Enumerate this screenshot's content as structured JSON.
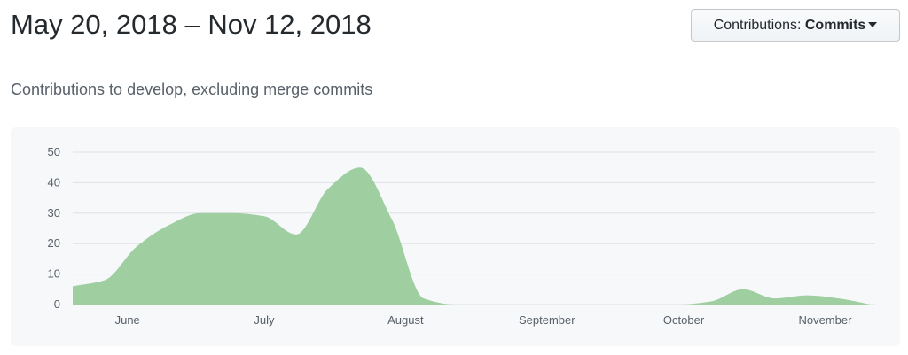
{
  "header": {
    "date_range": "May 20, 2018 – Nov 12, 2018",
    "contributions_button": {
      "prefix": "Contributions: ",
      "value": "Commits"
    }
  },
  "subtitle": "Contributions to develop, excluding merge commits",
  "colors": {
    "area_fill": "#9fcea1",
    "grid": "#dfe2e5",
    "chart_bg": "#f6f8fa"
  },
  "chart_data": {
    "type": "area",
    "title": "",
    "xlabel": "",
    "ylabel": "",
    "ylim": [
      0,
      50
    ],
    "yticks": [
      0,
      10,
      20,
      30,
      40,
      50
    ],
    "xlim": [
      "2018-05-20",
      "2018-11-12"
    ],
    "xtick_labels": [
      {
        "label": "June",
        "date": "2018-06-01"
      },
      {
        "label": "July",
        "date": "2018-07-01"
      },
      {
        "label": "August",
        "date": "2018-08-01"
      },
      {
        "label": "September",
        "date": "2018-09-01"
      },
      {
        "label": "October",
        "date": "2018-10-01"
      },
      {
        "label": "November",
        "date": "2018-11-01"
      }
    ],
    "grid": true,
    "series": [
      {
        "x": [
          "2018-05-20",
          "2018-05-27",
          "2018-06-03",
          "2018-06-10",
          "2018-06-17",
          "2018-06-24",
          "2018-07-01",
          "2018-07-08",
          "2018-07-15",
          "2018-07-22",
          "2018-07-29",
          "2018-08-05",
          "2018-08-12",
          "2018-08-19",
          "2018-08-26",
          "2018-09-02",
          "2018-09-09",
          "2018-09-16",
          "2018-09-23",
          "2018-09-30",
          "2018-10-07",
          "2018-10-14",
          "2018-10-21",
          "2018-10-28",
          "2018-11-04",
          "2018-11-11"
        ],
        "values": [
          6,
          8,
          19,
          26,
          30,
          30,
          29,
          23,
          38,
          45,
          28,
          2,
          0,
          0,
          0,
          0,
          0,
          0,
          0,
          0,
          1,
          5,
          2,
          3,
          2,
          0
        ]
      }
    ]
  }
}
